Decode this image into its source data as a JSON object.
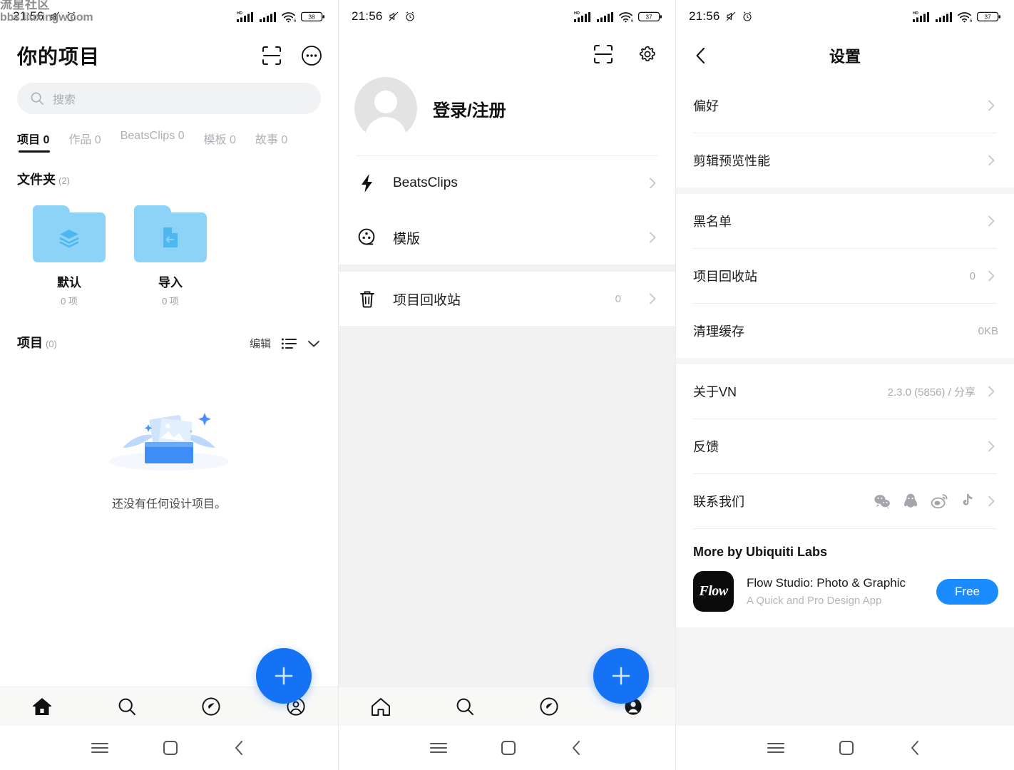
{
  "watermark": {
    "line1": "流星社区",
    "line2": "bbs.liuxingw.com"
  },
  "status_bars": [
    {
      "time": "21:56",
      "battery": "38",
      "wifi_gen": "6",
      "net": "HD"
    },
    {
      "time": "21:56",
      "battery": "37",
      "wifi_gen": "6",
      "net": "HD"
    },
    {
      "time": "21:56",
      "battery": "37",
      "wifi_gen": "6",
      "net": "HD"
    }
  ],
  "projects_screen": {
    "title": "你的项目",
    "actions": {
      "scan": "scan-icon",
      "more": "more-circle-icon"
    },
    "search": {
      "placeholder": "搜索"
    },
    "tabs": [
      {
        "label": "项目 0",
        "active": true
      },
      {
        "label": "作品 0",
        "active": false
      },
      {
        "label": "BeatsClips 0",
        "active": false
      },
      {
        "label": "模板 0",
        "active": false
      },
      {
        "label": "故事 0",
        "active": false
      }
    ],
    "folders_section": {
      "title": "文件夹",
      "count": "(2)"
    },
    "folders": [
      {
        "name": "默认",
        "items": "0 项",
        "icon": "layers-icon"
      },
      {
        "name": "导入",
        "items": "0 项",
        "icon": "document-import-icon"
      }
    ],
    "projects_section": {
      "title": "项目",
      "count": "(0)",
      "edit": "编辑"
    },
    "empty_text": "还没有任何设计项目。",
    "fab": "+"
  },
  "profile_screen": {
    "login_label": "登录/注册",
    "menu": [
      {
        "label": "BeatsClips",
        "icon": "bolt-icon",
        "value": ""
      },
      {
        "label": "模版",
        "icon": "film-reel-icon",
        "value": ""
      },
      {
        "label": "项目回收站",
        "icon": "trash-icon",
        "value": "0"
      }
    ],
    "fab": "+"
  },
  "settings_screen": {
    "title": "设置",
    "back": "chevron-left-icon",
    "rows": [
      {
        "label": "偏好",
        "value": "",
        "chevron": true
      },
      {
        "label": "剪辑预览性能",
        "value": "",
        "chevron": true
      },
      {
        "label": "黑名单",
        "value": "",
        "chevron": true
      },
      {
        "label": "项目回收站",
        "value": "0",
        "chevron": true
      },
      {
        "label": "清理缓存",
        "value": "0KB",
        "chevron": false
      },
      {
        "label": "关于VN",
        "value": "2.3.0 (5856) / 分享",
        "chevron": true
      },
      {
        "label": "反馈",
        "value": "",
        "chevron": true
      }
    ],
    "contact": {
      "label": "联系我们",
      "socials": [
        "wechat-icon",
        "qq-icon",
        "weibo-icon",
        "tiktok-icon"
      ]
    },
    "more_by": {
      "title": "More by Ubiquiti Labs",
      "app_icon_text": "Flow",
      "app_name": "Flow Studio: Photo & Graphic",
      "app_sub": "A Quick and Pro Design App",
      "cta": "Free"
    }
  },
  "bottom_nav": {
    "items": [
      {
        "name": "home",
        "icon": "home-icon"
      },
      {
        "name": "search",
        "icon": "search-icon"
      },
      {
        "name": "explore",
        "icon": "compass-icon"
      },
      {
        "name": "profile",
        "icon": "person-circle-icon"
      }
    ],
    "active_left": "home",
    "active_mid": "profile"
  },
  "system_nav": {
    "items": [
      "menu-icon",
      "square-icon",
      "back-icon"
    ]
  },
  "colors": {
    "accent": "#1672f5",
    "folder": "#8cd3f7",
    "free_button": "#1a8cff"
  }
}
